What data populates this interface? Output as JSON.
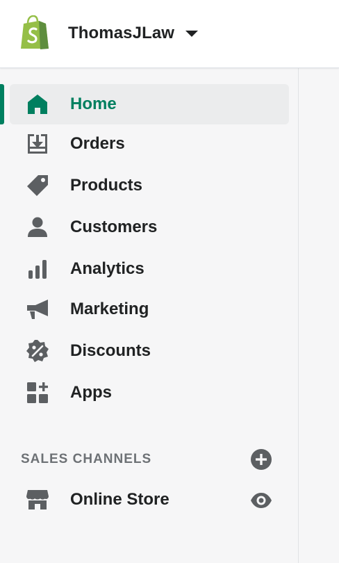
{
  "header": {
    "store_name": "ThomasJLaw",
    "logo_icon": "shopify-bag-icon",
    "brand_color": "#95bf47"
  },
  "sidebar": {
    "accent_color": "#008060",
    "items": [
      {
        "label": "Home",
        "icon": "home-icon",
        "active": true
      },
      {
        "label": "Orders",
        "icon": "orders-inbox-icon",
        "active": false
      },
      {
        "label": "Products",
        "icon": "tag-icon",
        "active": false
      },
      {
        "label": "Customers",
        "icon": "person-icon",
        "active": false
      },
      {
        "label": "Analytics",
        "icon": "bar-chart-icon",
        "active": false
      },
      {
        "label": "Marketing",
        "icon": "megaphone-icon",
        "active": false
      },
      {
        "label": "Discounts",
        "icon": "discount-badge-icon",
        "active": false
      },
      {
        "label": "Apps",
        "icon": "apps-grid-icon",
        "active": false
      }
    ],
    "sales_channels": {
      "title": "SALES CHANNELS",
      "add_icon": "plus-circle-icon",
      "items": [
        {
          "label": "Online Store",
          "icon": "storefront-icon",
          "action_icon": "eye-icon"
        }
      ]
    }
  }
}
